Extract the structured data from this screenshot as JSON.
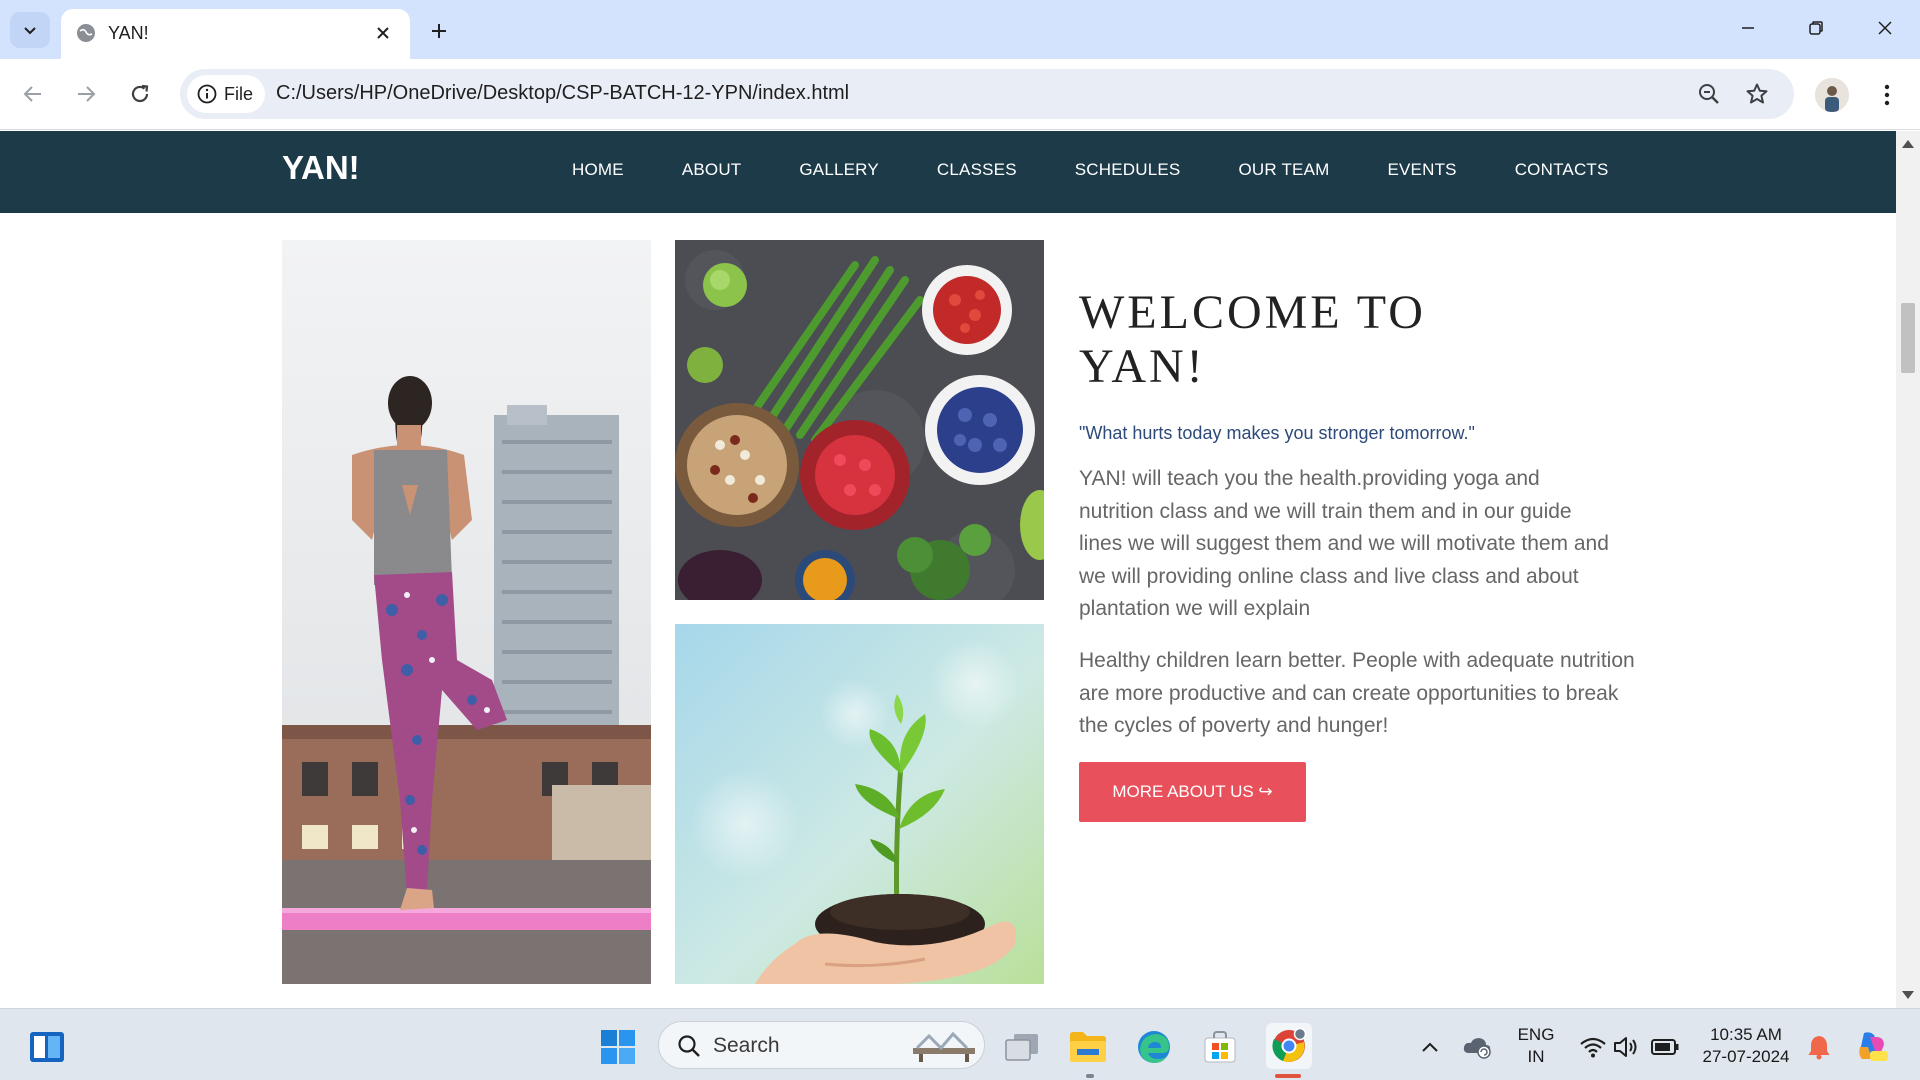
{
  "browser": {
    "tab_title": "YAN!",
    "chip_label": "File",
    "url": "C:/Users/HP/OneDrive/Desktop/CSP-BATCH-12-YPN/index.html"
  },
  "site": {
    "brand": "YAN!",
    "nav": [
      "HOME",
      "ABOUT",
      "GALLERY",
      "CLASSES",
      "SCHEDULES",
      "OUR TEAM",
      "EVENTS",
      "CONTACTS"
    ],
    "welcome_line1": "WELCOME TO",
    "welcome_line2": "YAN!",
    "quote": "\"What hurts today makes you stronger tomorrow.\"",
    "para1": "YAN! will teach you the health.providing yoga and nutrition class and we will train them and in our guide lines we will suggest them and we will motivate them and we will providing online class and live class and about plantation we will explain",
    "para2": "Healthy children learn better. People with adequate nutrition are more productive and can create opportunities to break the cycles of poverty and hunger!",
    "cta": "MORE ABOUT US ↪",
    "accent_color": "#e8505b",
    "nav_color": "#1d3a49"
  },
  "taskbar": {
    "search_label": "Search",
    "lang_top": "ENG",
    "lang_bottom": "IN",
    "time": "10:35 AM",
    "date": "27-07-2024"
  }
}
